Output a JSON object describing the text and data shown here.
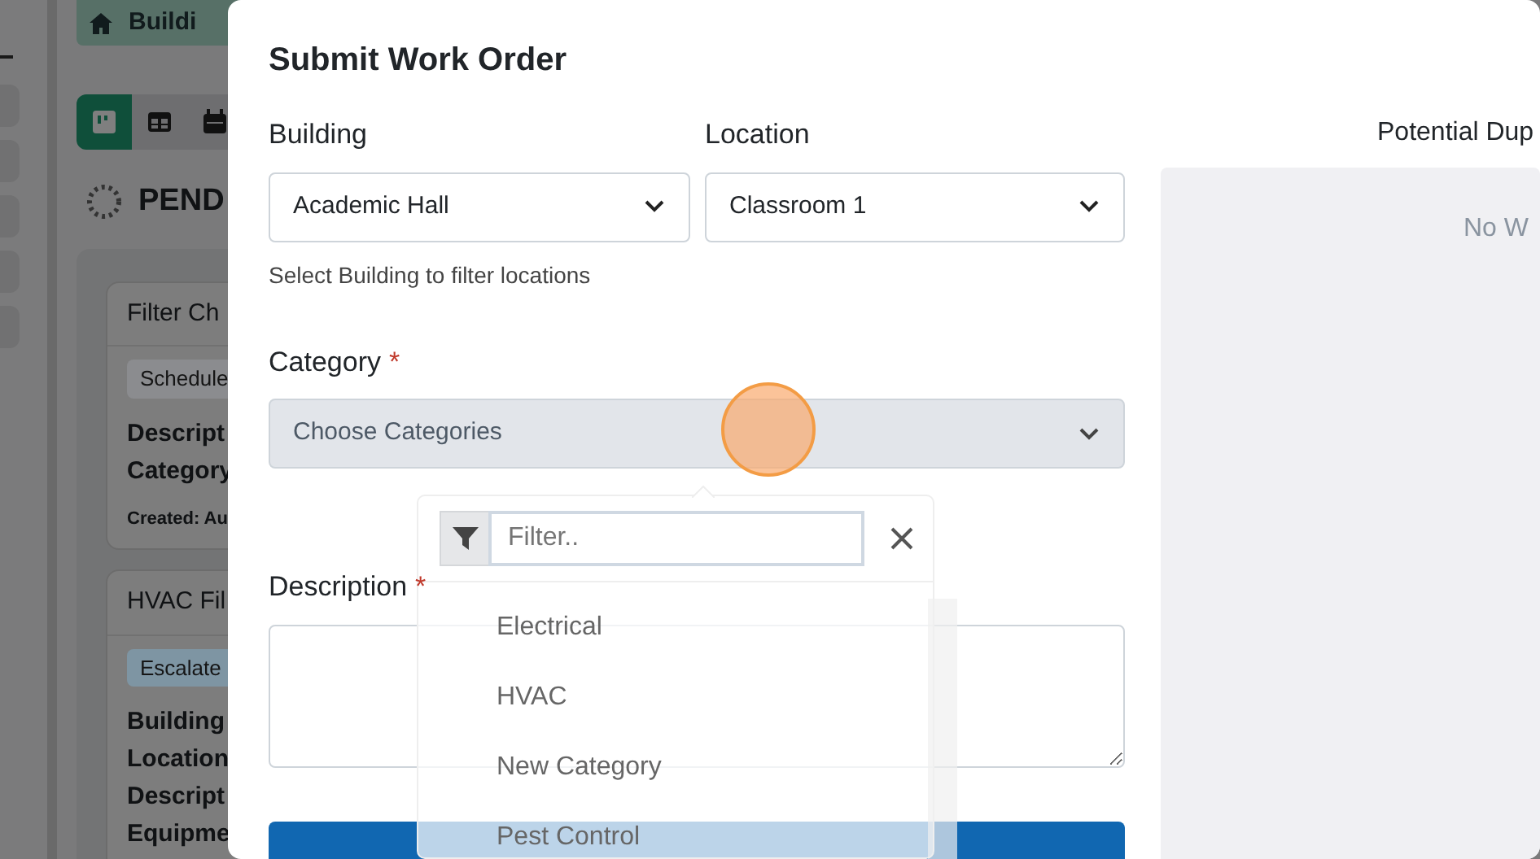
{
  "background": {
    "breadcrumb": "Buildi",
    "view_buttons": [
      {
        "selected": true
      },
      {
        "selected": false
      },
      {
        "selected": false
      }
    ],
    "section_title": "PEND",
    "cards": [
      {
        "title": "Filter Ch",
        "tag": "Schedule",
        "color": "#8b8c8f",
        "lines": [
          "Descript",
          "Category"
        ],
        "created": "Created:  Au"
      },
      {
        "title": "HVAC Fil",
        "tag": "Escalate",
        "color": "#7e95a3",
        "lines": [
          "Building",
          "Location",
          "Descript",
          "Equipme"
        ]
      }
    ]
  },
  "modal": {
    "title": "Submit Work Order",
    "building": {
      "label": "Building",
      "value": "Academic Hall",
      "help": "Select Building to filter locations"
    },
    "location": {
      "label": "Location",
      "value": "Classroom 1"
    },
    "category": {
      "label": "Category",
      "required_mark": "*",
      "placeholder": "Choose Categories"
    },
    "description": {
      "label": "Description",
      "required_mark": "*"
    },
    "duplicates": {
      "title": "Potential Dup",
      "empty_text": "No W"
    },
    "category_menu": {
      "filter_placeholder": "Filter..",
      "options": [
        "Electrical",
        "HVAC",
        "New Category",
        "Pest Control"
      ]
    }
  }
}
